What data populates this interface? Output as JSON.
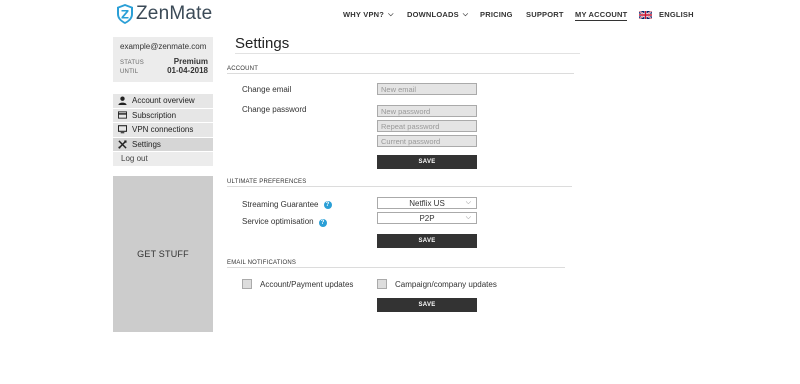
{
  "header": {
    "brand": "ZenMate",
    "nav": {
      "why_vpn": "WHY VPN?",
      "downloads": "DOWNLOADS",
      "pricing": "PRICING",
      "support": "SUPPORT",
      "my_account": "MY ACCOUNT",
      "language": "ENGLISH"
    }
  },
  "user": {
    "email": "example@zenmate.com",
    "status_label": "STATUS",
    "status_value": "Premium",
    "until_label": "UNTIL",
    "until_value": "01-04-2018"
  },
  "sidebar": {
    "items": [
      {
        "label": "Account overview",
        "icon": "user-icon"
      },
      {
        "label": "Subscription",
        "icon": "card-icon"
      },
      {
        "label": "VPN connections",
        "icon": "monitor-icon"
      },
      {
        "label": "Settings",
        "icon": "tools-icon",
        "active": true
      }
    ],
    "logout": "Log out",
    "promo": "GET STUFF"
  },
  "main": {
    "title": "Settings",
    "account": {
      "heading": "ACCOUNT",
      "change_email_label": "Change email",
      "change_password_label": "Change password",
      "new_email_placeholder": "New email",
      "new_password_placeholder": "New password",
      "repeat_password_placeholder": "Repeat password",
      "current_password_placeholder": "Current password",
      "save_label": "SAVE"
    },
    "preferences": {
      "heading": "ULTIMATE PREFERENCES",
      "streaming_label": "Streaming Guarantee",
      "streaming_value": "Netflix US",
      "service_label": "Service optimisation",
      "service_value": "P2P",
      "save_label": "SAVE"
    },
    "notifications": {
      "heading": "EMAIL NOTIFICATIONS",
      "account_payment": "Account/Payment updates",
      "campaign_company": "Campaign/company updates",
      "save_label": "SAVE"
    }
  },
  "colors": {
    "brand": "#2a9fd6",
    "button": "#333333",
    "sidebar": "#e6e6e6",
    "promo": "#cccccc"
  }
}
